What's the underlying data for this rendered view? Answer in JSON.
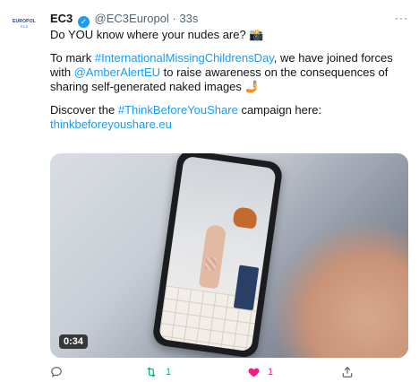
{
  "tweet": {
    "avatar": {
      "line1": "EUROPOL",
      "line2": "EC3"
    },
    "name": "EC3",
    "handle": "@EC3Europol",
    "separator": "·",
    "time": "33s",
    "more": "···",
    "line1": "Do YOU know where your nudes are? 📸",
    "p2_before": "To mark ",
    "p2_hashtag": "#InternationalMissingChildrensDay",
    "p2_mid": ", we have  joined forces with ",
    "p2_mention": "@AmberAlertEU",
    "p2_after": " to raise awareness on the consequences of sharing self-generated naked images 🤳",
    "p3_before": "Discover the ",
    "p3_hashtag": "#ThinkBeforeYouShare",
    "p3_after": " campaign here:",
    "p3_link": "thinkbeforeyoushare.eu",
    "video_duration": "0:34",
    "retweets": "1",
    "likes": "1"
  },
  "colors": {
    "link": "#1d9bf0",
    "retweet_active": "#00ba7c",
    "like_active": "#f91880",
    "secondary_text": "#536471"
  },
  "icons": [
    "verified-badge-icon",
    "more-icon",
    "reply-icon",
    "retweet-icon",
    "like-icon",
    "share-icon"
  ]
}
